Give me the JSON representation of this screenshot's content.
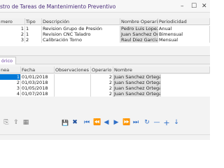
{
  "window": {
    "title": "stro de Tareas de Mantenimiento Preventivo",
    "controls": [
      "minimize-icon",
      "maximize-icon",
      "close-icon"
    ]
  },
  "tasks": {
    "headers": [
      "mero",
      "Tipo",
      "Descripción",
      "Nombre Operario",
      "Periodicidad"
    ],
    "rows": [
      [
        "1",
        "1",
        "Revision Grupo de Presión",
        "Pedro Luis Lopez Serrano",
        "Anual"
      ],
      [
        "2",
        "1",
        "Revision CNC Taladro",
        "Juan Sanchez Ortega",
        "Bimensual"
      ],
      [
        "3",
        "2",
        "Calibración Torno",
        "Raul Diez Garcia",
        "Mensual"
      ]
    ]
  },
  "tabs": {
    "active": "órico"
  },
  "history": {
    "headers": [
      "nea",
      "Fecha",
      "Observaciones",
      "Operario",
      "Nombre"
    ],
    "rows": [
      [
        "1",
        "01/01/2018",
        "",
        "2",
        "Juan Sanchez Ortega"
      ],
      [
        "2",
        "01/03/2018",
        "",
        "2",
        "Juan Sanchez Ortega"
      ],
      [
        "3",
        "01/05/2018",
        "",
        "2",
        "Juan Sanchez Ortega"
      ],
      [
        "4",
        "01/07/2018",
        "",
        "2",
        "Juan Sanchez Ortega"
      ]
    ]
  },
  "toolbar": {
    "icons": [
      "export-icon",
      "import-icon",
      "columns-icon",
      "save-icon",
      "delete-icon",
      "first-record-icon",
      "previous-page-icon",
      "previous-record-icon",
      "next-record-icon",
      "next-page-icon",
      "last-record-icon",
      "refresh-icon",
      "remove-icon",
      "add-icon",
      "move-down-icon"
    ],
    "glyphs": [
      "⎘",
      "⇪",
      "▦",
      "💾",
      "✖",
      "⏮",
      "⏪",
      "◀",
      "▶",
      "⏩",
      "⏭",
      "↻",
      "—",
      "+",
      "↓"
    ]
  },
  "colors": {
    "selection": "#0078d7",
    "title": "#4a2d7a",
    "toolbar_icons": "#2f6fc7"
  }
}
